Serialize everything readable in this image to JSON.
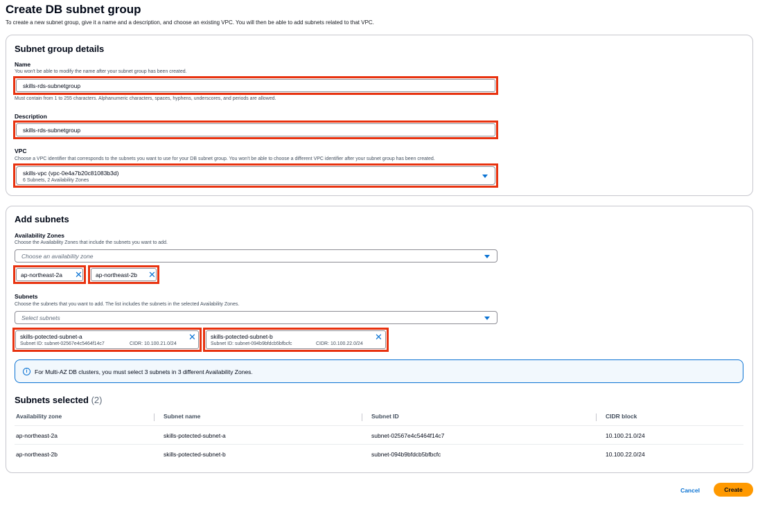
{
  "page": {
    "title": "Create DB subnet group",
    "description": "To create a new subnet group, give it a name and a description, and choose an existing VPC. You will then be able to add subnets related to that VPC."
  },
  "details": {
    "heading": "Subnet group details",
    "name_label": "Name",
    "name_hint": "You won't be able to modify the name after your subnet group has been created.",
    "name_value": "skills-rds-subnetgroup",
    "name_constraint": "Must contain from 1 to 255 characters. Alphanumeric characters, spaces, hyphens, underscores, and periods are allowed.",
    "desc_label": "Description",
    "desc_value": "skills-rds-subnetgroup",
    "vpc_label": "VPC",
    "vpc_hint": "Choose a VPC identifier that corresponds to the subnets you want to use for your DB subnet group. You won't be able to choose a different VPC identifier after your subnet group has been created.",
    "vpc_value": "skills-vpc (vpc-0e4a7b20c81083b3d)",
    "vpc_sub": "6 Subnets, 2 Availability Zones"
  },
  "add_subnets": {
    "heading": "Add subnets",
    "az_label": "Availability Zones",
    "az_hint": "Choose the Availability Zones that include the subnets you want to add.",
    "az_placeholder": "Choose an availability zone",
    "az_tokens": [
      "ap-northeast-2a",
      "ap-northeast-2b"
    ],
    "subnets_label": "Subnets",
    "subnets_hint": "Choose the subnets that you want to add. The list includes the subnets in the selected Availability Zones.",
    "subnets_placeholder": "Select subnets",
    "subnet_tokens": [
      {
        "name": "skills-potected-subnet-a",
        "id": "Subnet ID: subnet-02567e4c5464f14c7",
        "cidr": "CIDR: 10.100.21.0/24"
      },
      {
        "name": "skills-potected-subnet-b",
        "id": "Subnet ID: subnet-094b9bfdcb5bfbcfc",
        "cidr": "CIDR: 10.100.22.0/24"
      }
    ],
    "info_text": "For Multi-AZ DB clusters, you must select 3 subnets in 3 different Availability Zones."
  },
  "selected": {
    "heading": "Subnets selected",
    "count": "(2)",
    "columns": [
      "Availability zone",
      "Subnet name",
      "Subnet ID",
      "CIDR block"
    ],
    "rows": [
      [
        "ap-northeast-2a",
        "skills-potected-subnet-a",
        "subnet-02567e4c5464f14c7",
        "10.100.21.0/24"
      ],
      [
        "ap-northeast-2b",
        "skills-potected-subnet-b",
        "subnet-094b9bfdcb5bfbcfc",
        "10.100.22.0/24"
      ]
    ]
  },
  "footer": {
    "cancel_label": "Cancel",
    "create_label": "Create"
  },
  "colors": {
    "accent": "#0972d3",
    "primary_button": "#ff9900",
    "highlight": "#e8320f"
  }
}
